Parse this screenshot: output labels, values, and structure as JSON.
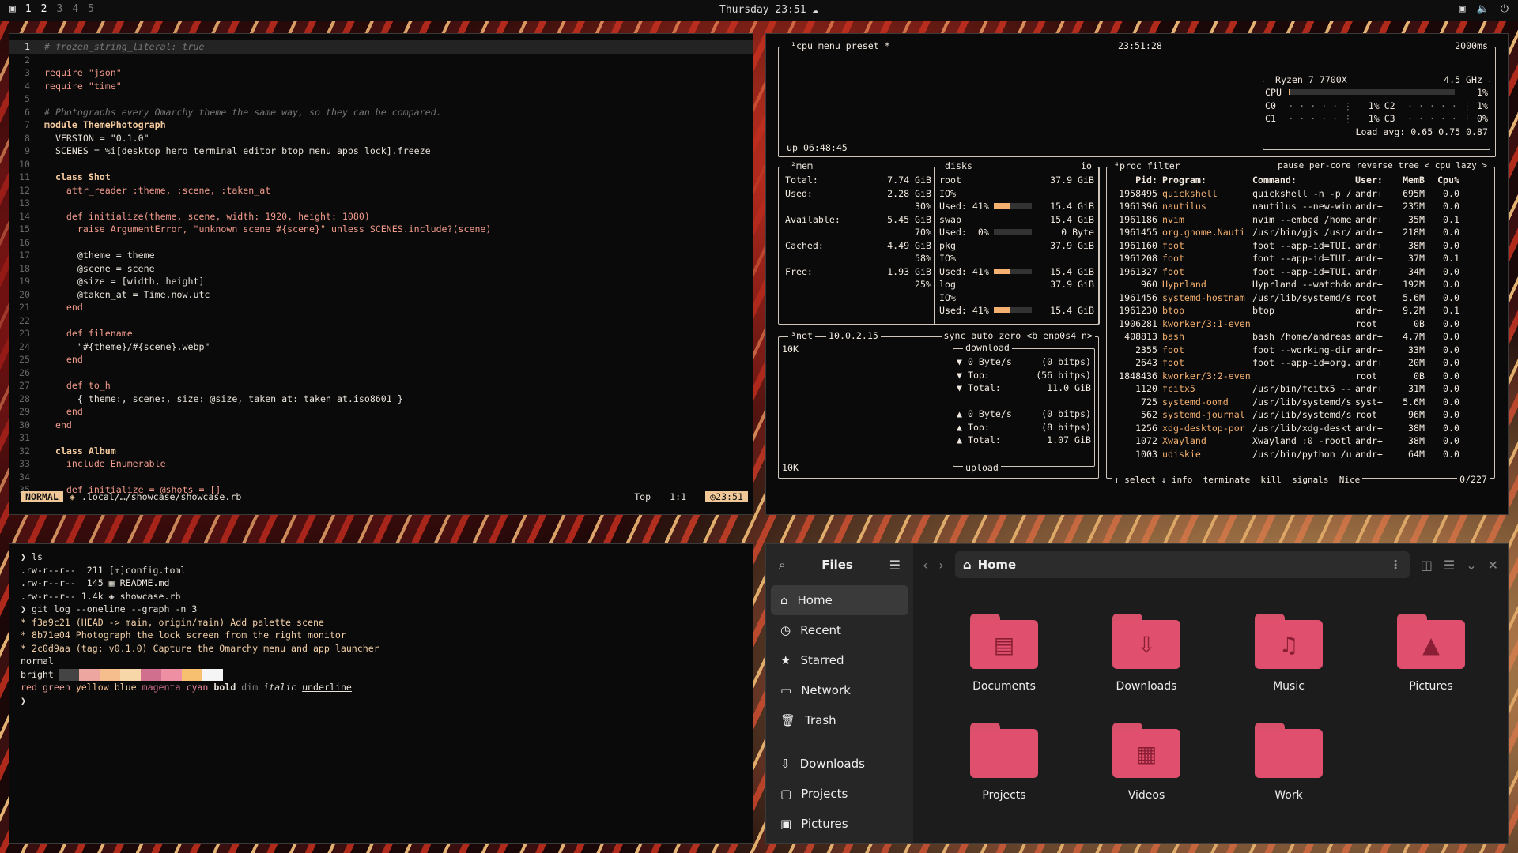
{
  "topbar": {
    "workspaces": [
      "1",
      "2",
      "3",
      "4",
      "5"
    ],
    "clock": "Thursday 23:51"
  },
  "editor": {
    "lines": [
      "# frozen_string_literal: true",
      "",
      "require \"json\"",
      "require \"time\"",
      "",
      "# Photographs every Omarchy theme the same way, so they can be compared.",
      "module ThemePhotograph",
      "  VERSION = \"0.1.0\"",
      "  SCENES = %i[desktop hero terminal editor btop menu apps lock].freeze",
      "",
      "  class Shot",
      "    attr_reader :theme, :scene, :taken_at",
      "",
      "    def initialize(theme, scene, width: 1920, height: 1080)",
      "      raise ArgumentError, \"unknown scene #{scene}\" unless SCENES.include?(scene)",
      "",
      "      @theme = theme",
      "      @scene = scene",
      "      @size = [width, height]",
      "      @taken_at = Time.now.utc",
      "    end",
      "",
      "    def filename",
      "      \"#{theme}/#{scene}.webp\"",
      "    end",
      "",
      "    def to_h",
      "      { theme:, scene:, size: @size, taken_at: taken_at.iso8601 }",
      "    end",
      "  end",
      "",
      "  class Album",
      "    include Enumerable",
      "",
      "    def initialize = @shots = []"
    ],
    "status": {
      "mode": "NORMAL",
      "file": ".local/…/showcase/showcase.rb",
      "pos_label": "Top",
      "cursor": "1:1",
      "time": "23:51"
    }
  },
  "btop": {
    "cpu_header": {
      "tabs": "¹cpu menu preset *",
      "time": "23:51:28",
      "interval": "2000ms",
      "uptime": "up 06:48:45"
    },
    "cpu_box": {
      "model": "Ryzen 7 7700X",
      "freq": "4.5 GHz",
      "rows": [
        [
          "CPU",
          "",
          "1%"
        ],
        [
          "C0",
          "1%",
          "C2",
          "1%"
        ],
        [
          "C1",
          "1%",
          "C3",
          "0%"
        ]
      ],
      "loadavg": "Load avg: 0.65 0.75 0.87"
    },
    "mem": {
      "title": "²mem",
      "rows": [
        [
          "Total:",
          "7.74 GiB"
        ],
        [
          "Used:",
          "2.28 GiB"
        ],
        [
          "",
          "30%"
        ],
        [
          "Available:",
          "5.45 GiB"
        ],
        [
          "",
          "70%"
        ],
        [
          "Cached:",
          "4.49 GiB"
        ],
        [
          "",
          "58%"
        ],
        [
          "Free:",
          "1.93 GiB"
        ],
        [
          "",
          "25%"
        ]
      ]
    },
    "disks": {
      "title": "disks",
      "io": "io",
      "rows": [
        [
          "root",
          "37.9 GiB"
        ],
        [
          "IO%",
          ""
        ],
        [
          "Used: 41%",
          "15.4 GiB"
        ],
        [
          "swap",
          "15.4 GiB"
        ],
        [
          "Used:  0%",
          "0 Byte"
        ],
        [
          "pkg",
          "37.9 GiB"
        ],
        [
          "IO%",
          ""
        ],
        [
          "Used: 41%",
          "15.4 GiB"
        ],
        [
          "log",
          "37.9 GiB"
        ],
        [
          "IO%",
          ""
        ],
        [
          "Used: 41%",
          "15.4 GiB"
        ]
      ],
      "used_pct": 41
    },
    "net": {
      "title": "³net",
      "ip": "10.0.2.15",
      "tabs": "sync auto zero <b enp0s4 n>",
      "scale_top": "10K",
      "scale_bot": "10K",
      "download_label": "download",
      "upload_label": "upload",
      "rows": [
        [
          "▼ 0 Byte/s",
          "(0 bitps)"
        ],
        [
          "▼ Top:",
          "(56 bitps)"
        ],
        [
          "▼ Total:",
          "11.0 GiB"
        ],
        [
          "▲ 0 Byte/s",
          "(0 bitps)"
        ],
        [
          "▲ Top:",
          "(8 bitps)"
        ],
        [
          "▲ Total:",
          "1.07 GiB"
        ]
      ]
    },
    "proc": {
      "title": "⁴proc filter",
      "tabs": "pause per-core reverse tree < cpu lazy >",
      "headers": [
        "Pid:",
        "Program:",
        "Command:",
        "User:",
        "MemB",
        "Cpu%"
      ],
      "rows": [
        [
          "1958495",
          "quickshell",
          "quickshell -n -p /",
          "andr+",
          "695M",
          "0.0"
        ],
        [
          "1961396",
          "nautilus",
          "nautilus --new-win",
          "andr+",
          "235M",
          "0.0"
        ],
        [
          "1961186",
          "nvim",
          "nvim --embed /home",
          "andr+",
          "35M",
          "0.1"
        ],
        [
          "1961455",
          "org.gnome.Nauti",
          "/usr/bin/gjs /usr/",
          "andr+",
          "218M",
          "0.0"
        ],
        [
          "1961160",
          "foot",
          "foot --app-id=TUI.",
          "andr+",
          "38M",
          "0.0"
        ],
        [
          "1961208",
          "foot",
          "foot --app-id=TUI.",
          "andr+",
          "37M",
          "0.1"
        ],
        [
          "1961327",
          "foot",
          "foot --app-id=TUI.",
          "andr+",
          "34M",
          "0.0"
        ],
        [
          "960",
          "Hyprland",
          "Hyprland --watchdo",
          "andr+",
          "192M",
          "0.0"
        ],
        [
          "1961456",
          "systemd-hostnam",
          "/usr/lib/systemd/s",
          "root",
          "5.6M",
          "0.0"
        ],
        [
          "1961230",
          "btop",
          "btop",
          "andr+",
          "9.2M",
          "0.1"
        ],
        [
          "1906281",
          "kworker/3:1-even",
          "",
          "root",
          "0B",
          "0.0"
        ],
        [
          "408813",
          "bash",
          "bash /home/andreas",
          "andr+",
          "4.7M",
          "0.0"
        ],
        [
          "2355",
          "foot",
          "foot --working-dir",
          "andr+",
          "33M",
          "0.0"
        ],
        [
          "2643",
          "foot",
          "foot --app-id=org.",
          "andr+",
          "20M",
          "0.0"
        ],
        [
          "1848436",
          "kworker/3:2-even",
          "",
          "root",
          "0B",
          "0.0"
        ],
        [
          "1120",
          "fcitx5",
          "/usr/bin/fcitx5 --",
          "andr+",
          "31M",
          "0.0"
        ],
        [
          "725",
          "systemd-oomd",
          "/usr/lib/systemd/s",
          "syst+",
          "5.6M",
          "0.0"
        ],
        [
          "562",
          "systemd-journal",
          "/usr/lib/systemd/s",
          "root",
          "96M",
          "0.0"
        ],
        [
          "1256",
          "xdg-desktop-por",
          "/usr/lib/xdg-deskt",
          "andr+",
          "38M",
          "0.0"
        ],
        [
          "1072",
          "Xwayland",
          "Xwayland :0 -rootl",
          "andr+",
          "38M",
          "0.0"
        ],
        [
          "1003",
          "udiskie",
          "/usr/bin/python /u",
          "andr+",
          "64M",
          "0.0"
        ]
      ],
      "footer": "↑ select ↓ info  terminate  kill  signals  Nice",
      "count": "0/227"
    }
  },
  "terminal": {
    "lines": [
      "❯ ls",
      ".rw-r--r--  211 [↑]config.toml",
      ".rw-r--r--  145 ▦ README.md",
      ".rw-r--r-- 1.4k ◈ showcase.rb",
      "❯ git log --oneline --graph -n 3",
      "* f3a9c21 (HEAD -> main, origin/main) Add palette scene",
      "* 8b71e04 Photograph the lock screen from the right monitor",
      "* 2c0d9aa (tag: v0.1.0) Capture the Omarchy menu and app launcher"
    ],
    "palette_normal_label": "normal",
    "palette_bright_label": "bright",
    "palette_normal": [
      "#0a0a0a",
      "#0a0a0a",
      "#0a0a0a",
      "#0a0a0a",
      "#0a0a0a",
      "#0a0a0a",
      "#0a0a0a",
      "#0a0a0a"
    ],
    "palette_bright": [
      "#444444",
      "#eea6a0",
      "#f6be8c",
      "#f7d6a8",
      "#d0708e",
      "#ee8fa4",
      "#f6c070",
      "#f5f5f5"
    ],
    "styles_line": [
      "red",
      "green",
      "yellow",
      "blue",
      "magenta",
      "cyan",
      "bold",
      "dim",
      "italic",
      "underline"
    ],
    "prompt": "❯"
  },
  "files": {
    "title": "Files",
    "location": "Home",
    "sidebar": [
      "Home",
      "Recent",
      "Starred",
      "Network",
      "Trash"
    ],
    "bookmarks": [
      "Downloads",
      "Projects",
      "Pictures"
    ],
    "folders": [
      {
        "name": "Documents",
        "icon": "document-icon"
      },
      {
        "name": "Downloads",
        "icon": "download-icon"
      },
      {
        "name": "Music",
        "icon": "music-icon"
      },
      {
        "name": "Pictures",
        "icon": "picture-icon"
      },
      {
        "name": "Projects",
        "icon": "folder-icon"
      },
      {
        "name": "Videos",
        "icon": "film-icon"
      },
      {
        "name": "Work",
        "icon": "folder-icon"
      }
    ]
  }
}
